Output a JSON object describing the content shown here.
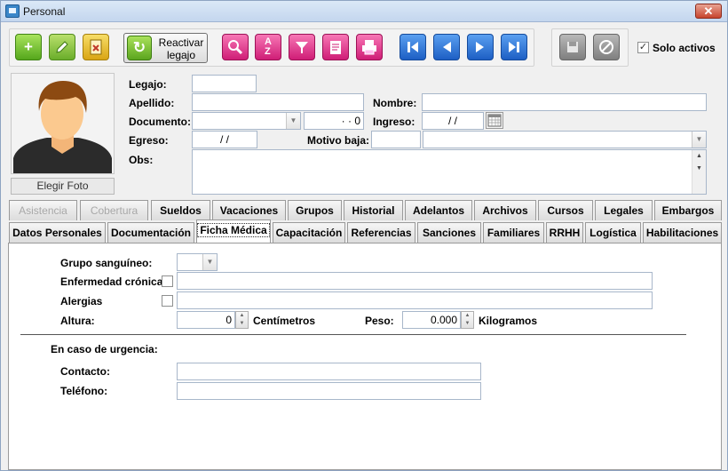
{
  "window": {
    "title": "Personal",
    "close_label": "✕"
  },
  "toolbar": {
    "reactivar_line1": "Reactivar",
    "reactivar_line2": "legajo",
    "solo_activos_label": "Solo activos",
    "solo_activos_checked": "✓"
  },
  "photo": {
    "elegir_foto_label": "Elegir Foto"
  },
  "form": {
    "legajo_label": "Legajo:",
    "legajo_value": "",
    "apellido_label": "Apellido:",
    "apellido_value": "",
    "nombre_label": "Nombre:",
    "nombre_value": "",
    "documento_label": "Documento:",
    "documento_type": "",
    "documento_number": "· · 0",
    "ingreso_label": "Ingreso:",
    "ingreso_value": "/ /",
    "egreso_label": "Egreso:",
    "egreso_value": "/ /",
    "motivo_baja_label": "Motivo baja:",
    "motivo_code": "",
    "motivo_desc": "",
    "obs_label": "Obs:",
    "obs_value": ""
  },
  "tabs_row1": [
    {
      "label": "Asistencia",
      "disabled": true
    },
    {
      "label": "Cobertura",
      "disabled": true
    },
    {
      "label": "Sueldos"
    },
    {
      "label": "Vacaciones"
    },
    {
      "label": "Grupos"
    },
    {
      "label": "Historial"
    },
    {
      "label": "Adelantos"
    },
    {
      "label": "Archivos"
    },
    {
      "label": "Cursos"
    },
    {
      "label": "Legales"
    },
    {
      "label": "Embargos"
    }
  ],
  "tabs_row2": [
    {
      "label": "Datos Personales"
    },
    {
      "label": "Documentación"
    },
    {
      "label": "Ficha Médica",
      "active": true
    },
    {
      "label": "Capacitación"
    },
    {
      "label": "Referencias"
    },
    {
      "label": "Sanciones"
    },
    {
      "label": "Familiares"
    },
    {
      "label": "RRHH"
    },
    {
      "label": "Logística"
    },
    {
      "label": "Habilitaciones"
    }
  ],
  "ficha": {
    "grupo_label": "Grupo sanguíneo:",
    "grupo_value": "",
    "enfermedad_label": "Enfermedad crónica",
    "enfermedad_text": "",
    "alergias_label": "Alergias",
    "alergias_text": "",
    "altura_label": "Altura:",
    "altura_value": "0",
    "altura_unit": "Centímetros",
    "peso_label": "Peso:",
    "peso_value": "0.000",
    "peso_unit": "Kilogramos",
    "urgencia_label": "En caso de urgencia:",
    "contacto_label": "Contacto:",
    "contacto_value": "",
    "telefono_label": "Teléfono:",
    "telefono_value": ""
  }
}
